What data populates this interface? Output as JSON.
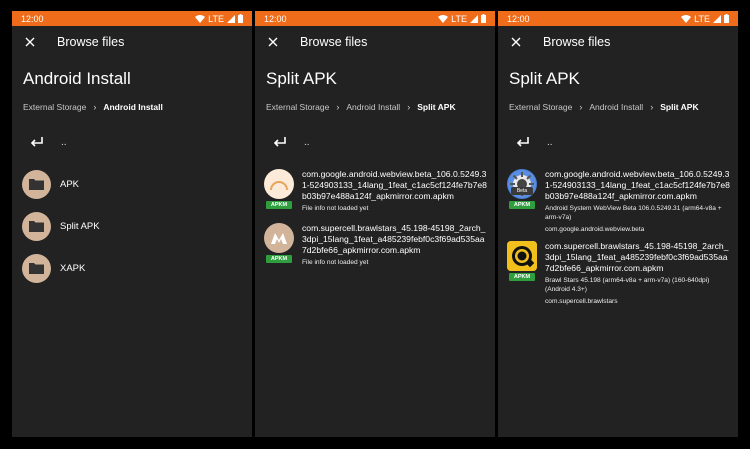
{
  "status": {
    "time": "12:00",
    "network": "LTE"
  },
  "colors": {
    "accent": "#ef6c1a",
    "background": "#222222",
    "badge": "#2e9e3e",
    "folder": "#d2b49b"
  },
  "screens": [
    {
      "toolbar_title": "Browse files",
      "heading": "Android Install",
      "breadcrumbs": [
        "External Storage",
        "Android Install"
      ],
      "up_label": "..",
      "folders": [
        {
          "label": "APK",
          "icon": "folder-icon"
        },
        {
          "label": "Split APK",
          "icon": "folder-icon"
        },
        {
          "label": "XAPK",
          "icon": "folder-icon"
        }
      ]
    },
    {
      "toolbar_title": "Browse files",
      "heading": "Split APK",
      "breadcrumbs": [
        "External Storage",
        "Android Install",
        "Split APK"
      ],
      "up_label": "..",
      "files": [
        {
          "name": "com.google.android.webview.beta_106.0.5249.31-524903133_14lang_1feat_c1ac5cf124fe7b7e8b03b97e488a124f_apkmirror.com.apkm",
          "badge": "APKM",
          "info": "File info not loaded yet",
          "icon": "placeholder-arc-icon"
        },
        {
          "name": "com.supercell.brawlstars_45.198-45198_2arch_3dpi_15lang_1feat_a485239febf0c3f69ad535aa7d2bfe66_apkmirror.com.apkm",
          "badge": "APKM",
          "info": "File info not loaded yet",
          "icon": "placeholder-m-icon"
        }
      ]
    },
    {
      "toolbar_title": "Browse files",
      "heading": "Split APK",
      "breadcrumbs": [
        "External Storage",
        "Android Install",
        "Split APK"
      ],
      "up_label": "..",
      "files": [
        {
          "name": "com.google.android.webview.beta_106.0.5249.31-524903133_14lang_1feat_c1ac5cf124fe7b7e8b03b97e488a124f_apkmirror.com.apkm",
          "badge": "APKM",
          "info": "Android System WebView Beta 106.0.5249.31 (arm64-v8a + arm-v7a)",
          "package": "com.google.android.webview.beta",
          "icon": "webview-beta-icon",
          "icon_label": "Beta"
        },
        {
          "name": "com.supercell.brawlstars_45.198-45198_2arch_3dpi_15lang_1feat_a485239febf0c3f69ad535aa7d2bfe66_apkmirror.com.apkm",
          "badge": "APKM",
          "info": "Brawl Stars 45.198 (arm64-v8a + arm-v7a) (160-640dpi) (Android 4.3+)",
          "package": "com.supercell.brawlstars",
          "icon": "brawl-stars-icon"
        }
      ]
    }
  ]
}
